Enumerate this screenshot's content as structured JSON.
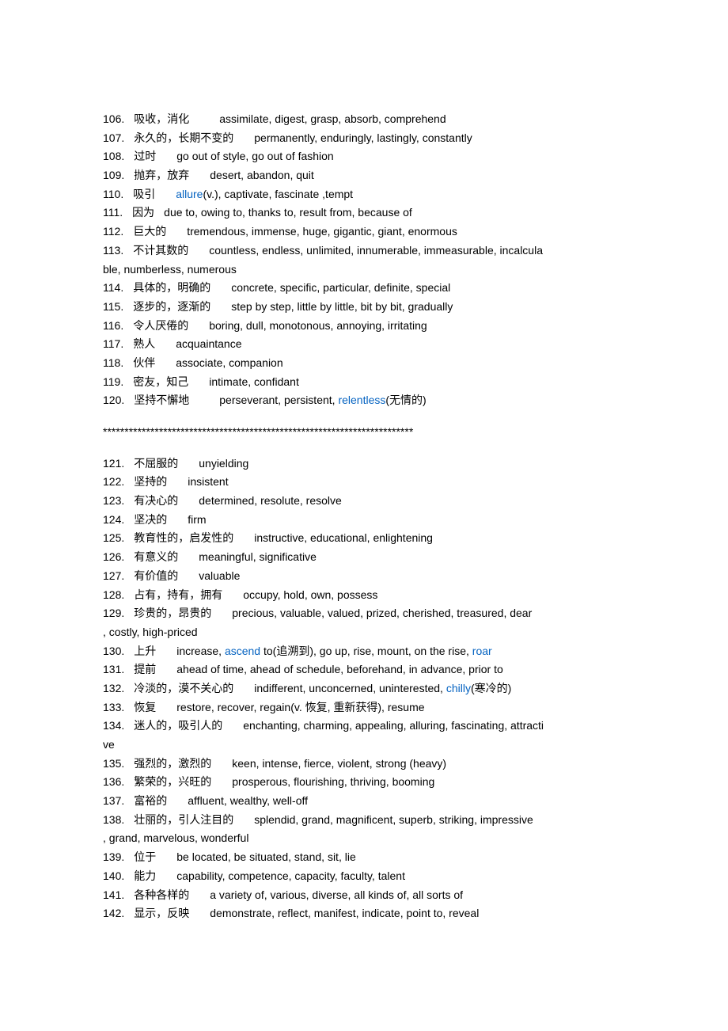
{
  "entries": [
    {
      "num": "106.",
      "cn": "吸收，消化",
      "gap": "lg",
      "parts": [
        {
          "t": "assimilate, digest, grasp, absorb, comprehend"
        }
      ]
    },
    {
      "num": "107.",
      "cn": "永久的，长期不变的",
      "gap": "md",
      "parts": [
        {
          "t": "permanently, enduringly, lastingly, constantly"
        }
      ]
    },
    {
      "num": "108.",
      "cn": "过时",
      "gap": "md",
      "parts": [
        {
          "t": "go out of style, go out of fashion"
        }
      ]
    },
    {
      "num": "109.",
      "cn": "抛弃，放弃",
      "gap": "md",
      "parts": [
        {
          "t": "desert, abandon, quit"
        }
      ]
    },
    {
      "num": "110.",
      "cn": "吸引",
      "gap": "md",
      "parts": [
        {
          "t": "allure",
          "c": "blue"
        },
        {
          "t": "(v.), captivate, fascinate ,tempt"
        }
      ]
    },
    {
      "num": "111.",
      "cn": "因为",
      "gap": "sm",
      "parts": [
        {
          "t": "due to, owing to, thanks to, result from, because of"
        }
      ]
    },
    {
      "num": "112.",
      "cn": "巨大的",
      "gap": "md",
      "parts": [
        {
          "t": "tremendous, immense, huge, gigantic, giant, enormous"
        }
      ]
    },
    {
      "num": "113.",
      "cn": "不计其数的",
      "gap": "md",
      "parts": [
        {
          "t": "countless, endless, unlimited, innumerable, immeasurable, incalcula"
        }
      ]
    }
  ],
  "cont113": "ble, numberless, numerous",
  "entries2": [
    {
      "num": "114.",
      "cn": "具体的，明确的",
      "gap": "md",
      "parts": [
        {
          "t": "concrete, specific, particular, definite, special"
        }
      ]
    },
    {
      "num": "115.",
      "cn": "逐步的，逐渐的",
      "gap": "md",
      "parts": [
        {
          "t": "step by step, little by little, bit by bit, gradually"
        }
      ]
    },
    {
      "num": "116.",
      "cn": "令人厌倦的",
      "gap": "md",
      "parts": [
        {
          "t": "boring, dull, monotonous, annoying, irritating"
        }
      ]
    },
    {
      "num": "117.",
      "cn": "熟人",
      "gap": "md",
      "parts": [
        {
          "t": "acquaintance"
        }
      ]
    },
    {
      "num": "118.",
      "cn": "伙伴",
      "gap": "md",
      "parts": [
        {
          "t": "associate, companion"
        }
      ]
    },
    {
      "num": "119.",
      "cn": "密友，知己",
      "gap": "md",
      "parts": [
        {
          "t": "intimate, confidant"
        }
      ]
    },
    {
      "num": "120.",
      "cn": "坚持不懈地",
      "gap": "lg",
      "parts": [
        {
          "t": "perseverant, persistent, "
        },
        {
          "t": "relentless",
          "c": "blue"
        },
        {
          "t": "(无情的)"
        }
      ]
    }
  ],
  "divider": "************************************************************************",
  "entries3": [
    {
      "num": "121.",
      "cn": "不屈服的",
      "gap": "md",
      "parts": [
        {
          "t": "unyielding"
        }
      ]
    },
    {
      "num": "122.",
      "cn": "坚持的",
      "gap": "md",
      "parts": [
        {
          "t": "insistent"
        }
      ]
    },
    {
      "num": "123.",
      "cn": "有决心的",
      "gap": "md",
      "parts": [
        {
          "t": "determined, resolute, resolve"
        }
      ]
    },
    {
      "num": "124.",
      "cn": "坚决的",
      "gap": "md",
      "parts": [
        {
          "t": "firm"
        }
      ]
    },
    {
      "num": "125.",
      "cn": "教育性的，启发性的",
      "gap": "md",
      "parts": [
        {
          "t": "instructive, educational, enlightening"
        }
      ]
    },
    {
      "num": "126.",
      "cn": "有意义的",
      "gap": "md",
      "parts": [
        {
          "t": "meaningful, significative"
        }
      ]
    },
    {
      "num": "127.",
      "cn": "有价值的",
      "gap": "md",
      "parts": [
        {
          "t": "valuable"
        }
      ]
    },
    {
      "num": "128.",
      "cn": "占有，持有，拥有",
      "gap": "md",
      "parts": [
        {
          "t": "occupy, hold, own, possess"
        }
      ]
    },
    {
      "num": "129.",
      "cn": "珍贵的，昂贵的",
      "gap": "md",
      "parts": [
        {
          "t": "precious, valuable, valued, prized, cherished, treasured, dear"
        }
      ]
    }
  ],
  "cont129": ", costly, high-priced",
  "entries4": [
    {
      "num": "130.",
      "cn": "上升",
      "gap": "md",
      "parts": [
        {
          "t": "increase, "
        },
        {
          "t": "ascend",
          "c": "blue"
        },
        {
          "t": " to(追溯到), go up, rise, mount, on the rise, "
        },
        {
          "t": "roar",
          "c": "blue"
        }
      ]
    },
    {
      "num": "131.",
      "cn": "提前",
      "gap": "md",
      "parts": [
        {
          "t": "ahead of time, ahead of schedule, beforehand, in advance, prior to"
        }
      ]
    },
    {
      "num": "132.",
      "cn": "冷淡的，漠不关心的",
      "gap": "md",
      "parts": [
        {
          "t": "indifferent, unconcerned, uninterested, "
        },
        {
          "t": "chilly",
          "c": "blue"
        },
        {
          "t": "(寒冷的)"
        }
      ]
    },
    {
      "num": "133.",
      "cn": "恢复",
      "gap": "md",
      "parts": [
        {
          "t": "restore, recover, regain(v. 恢复, 重新获得), resume"
        }
      ]
    },
    {
      "num": "134.",
      "cn": "迷人的，吸引人的",
      "gap": "md",
      "parts": [
        {
          "t": "enchanting, charming, appealing, alluring, fascinating, attracti"
        }
      ]
    }
  ],
  "cont134": "ve",
  "entries5": [
    {
      "num": "135.",
      "cn": "强烈的，激烈的",
      "gap": "md",
      "parts": [
        {
          "t": "keen, intense, fierce, violent, strong (heavy)"
        }
      ]
    },
    {
      "num": "136.",
      "cn": "繁荣的，兴旺的",
      "gap": "md",
      "parts": [
        {
          "t": "prosperous, flourishing, thriving, booming"
        }
      ]
    },
    {
      "num": "137.",
      "cn": "富裕的",
      "gap": "md",
      "parts": [
        {
          "t": "affluent, wealthy, well-off"
        }
      ]
    },
    {
      "num": "138.",
      "cn": "壮丽的，引人注目的",
      "gap": "md",
      "parts": [
        {
          "t": "splendid, grand, magnificent, superb, striking, impressive"
        }
      ]
    }
  ],
  "cont138": ", grand, marvelous, wonderful",
  "entries6": [
    {
      "num": "139.",
      "cn": "位于",
      "gap": "md",
      "parts": [
        {
          "t": "be located, be situated, stand, sit, lie"
        }
      ]
    },
    {
      "num": "140.",
      "cn": "能力",
      "gap": "md",
      "parts": [
        {
          "t": "capability, competence, capacity, faculty, talent"
        }
      ]
    },
    {
      "num": "141.",
      "cn": "各种各样的",
      "gap": "md",
      "parts": [
        {
          "t": "a variety of, various, diverse, all kinds of, all sorts of"
        }
      ]
    },
    {
      "num": "142.",
      "cn": "显示，反映",
      "gap": "md",
      "parts": [
        {
          "t": "demonstrate, reflect, manifest, indicate, point to, reveal"
        }
      ]
    }
  ]
}
